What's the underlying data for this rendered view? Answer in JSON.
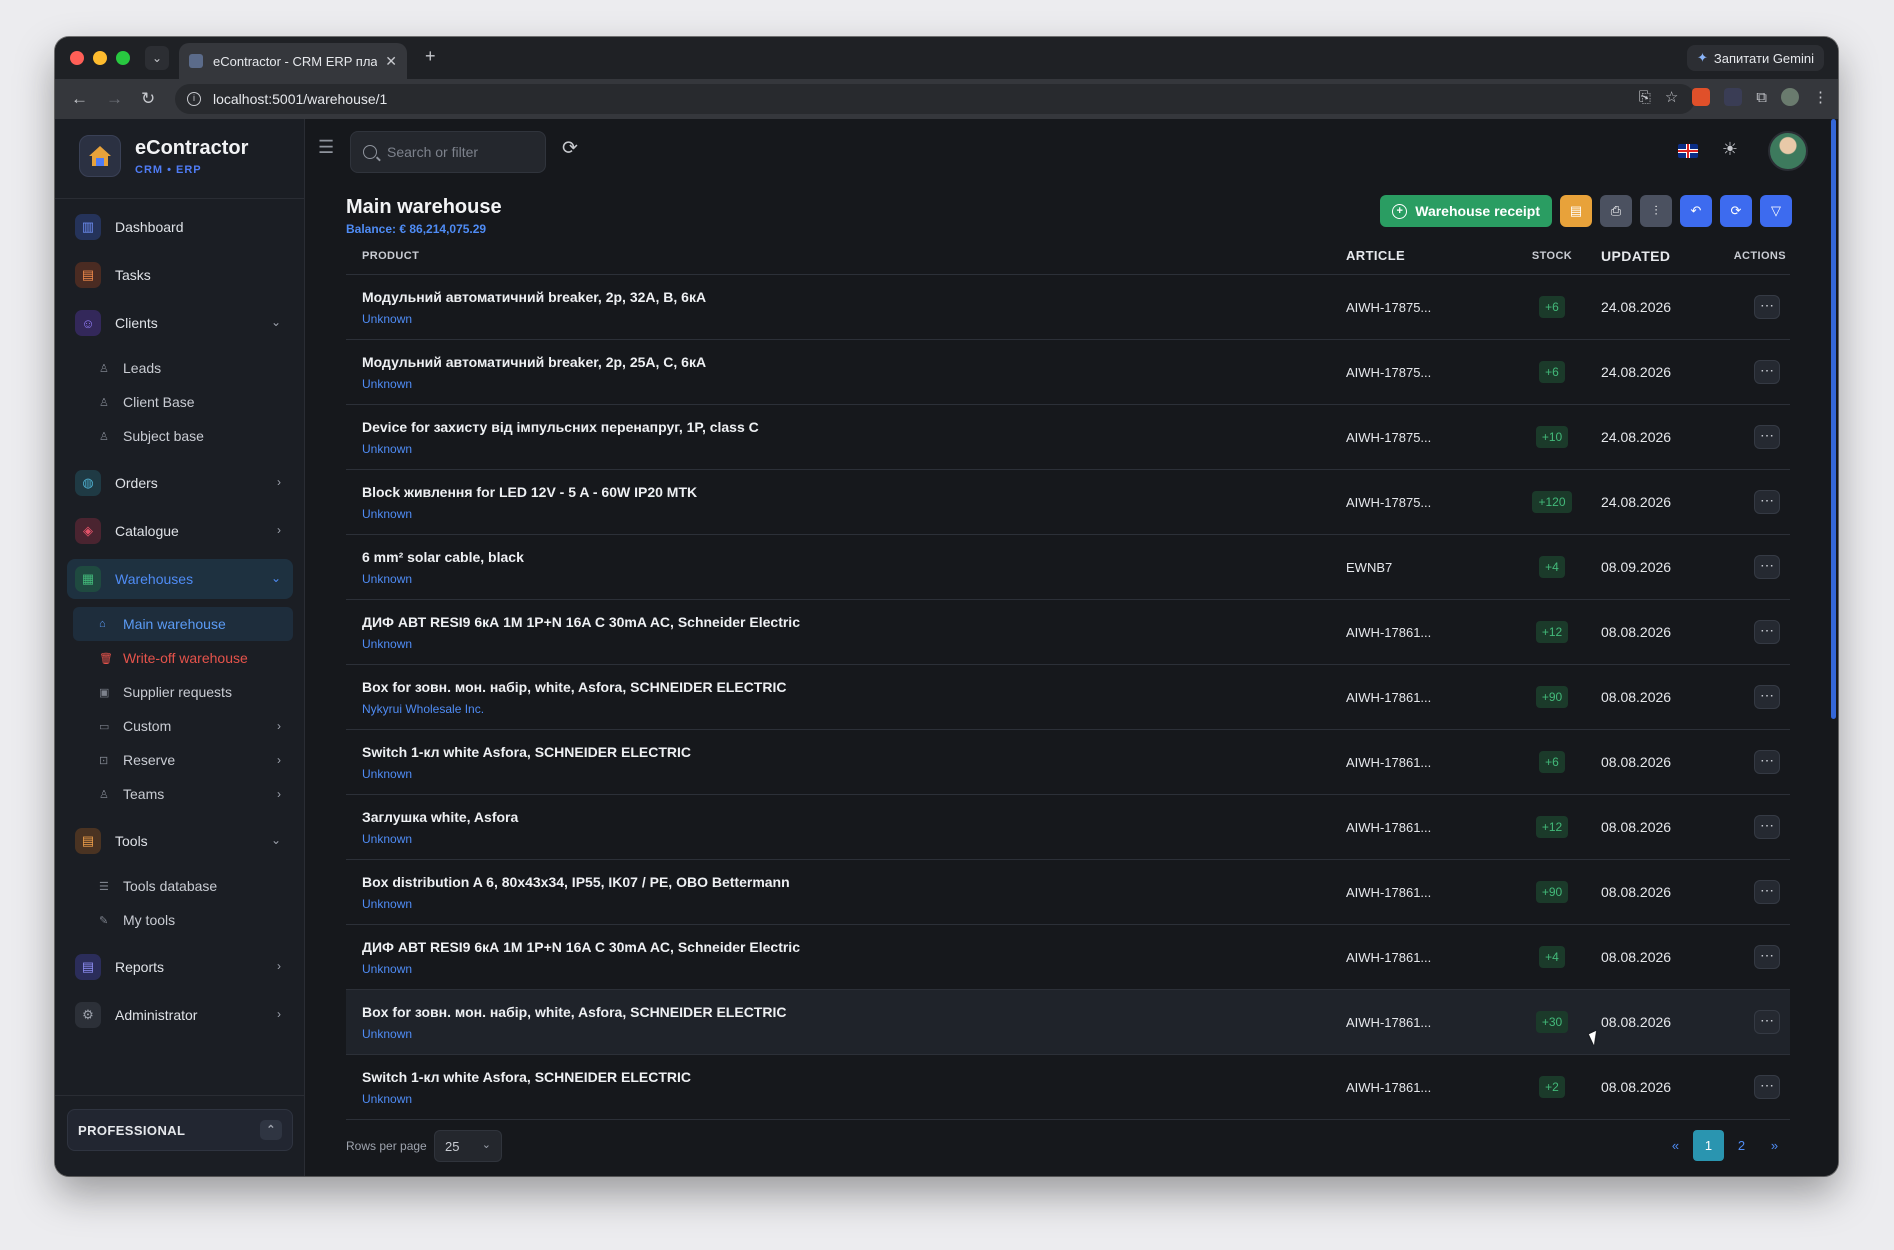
{
  "browser": {
    "tab_title": "eContractor - CRM ERP плат",
    "gemini_label": "Запитати Gemini",
    "url": "localhost:5001/warehouse/1"
  },
  "brand": {
    "name": "eContractor",
    "sub": "CRM • ERP"
  },
  "nav": {
    "dashboard": "Dashboard",
    "tasks": "Tasks",
    "clients": "Clients",
    "leads": "Leads",
    "client_base": "Client Base",
    "subject_base": "Subject base",
    "orders": "Orders",
    "catalogue": "Catalogue",
    "warehouses": "Warehouses",
    "main_warehouse": "Main warehouse",
    "writeoff_warehouse": "Write-off warehouse",
    "supplier_requests": "Supplier requests",
    "custom": "Custom",
    "reserve": "Reserve",
    "teams": "Teams",
    "tools": "Tools",
    "tools_database": "Tools database",
    "my_tools": "My tools",
    "reports": "Reports",
    "administrator": "Administrator"
  },
  "plan": "PROFESSIONAL",
  "search": {
    "placeholder": "Search or filter"
  },
  "page": {
    "title": "Main warehouse",
    "balance": "Balance: € 86,214,075.29"
  },
  "toolbar": {
    "receipt_label": "Warehouse receipt"
  },
  "table": {
    "headers": {
      "product": "PRODUCT",
      "article": "ARTICLE",
      "stock": "STOCK",
      "updated": "UPDATED",
      "actions": "ACTIONS"
    },
    "rows": [
      {
        "name": "Модульний автоматичний breaker, 2p, 32A, B, 6кA",
        "supplier": "Unknown",
        "article": "AIWH-17875...",
        "stock": "+6",
        "updated": "24.08.2026"
      },
      {
        "name": "Модульний автоматичний breaker, 2p, 25A, C, 6кA",
        "supplier": "Unknown",
        "article": "AIWH-17875...",
        "stock": "+6",
        "updated": "24.08.2026"
      },
      {
        "name": "Device for захисту від імпульсних перенапруг, 1P, class C",
        "supplier": "Unknown",
        "article": "AIWH-17875...",
        "stock": "+10",
        "updated": "24.08.2026"
      },
      {
        "name": "Block живлення for LED 12V - 5 A - 60W IP20 MTK",
        "supplier": "Unknown",
        "article": "AIWH-17875...",
        "stock": "+120",
        "updated": "24.08.2026"
      },
      {
        "name": "6 mm² solar cable, black",
        "supplier": "Unknown",
        "article": "EWNB7",
        "stock": "+4",
        "updated": "08.09.2026"
      },
      {
        "name": "ДИФ АВТ RESI9 6кА 1М 1P+N 16A C 30mA AC, Schneider Electric",
        "supplier": "Unknown",
        "article": "AIWH-17861...",
        "stock": "+12",
        "updated": "08.08.2026"
      },
      {
        "name": "Box for зовн. мон. набір, white, Asfora, SCHNEIDER ELECTRIC",
        "supplier": "Nykyrui Wholesale Inc.",
        "article": "AIWH-17861...",
        "stock": "+90",
        "updated": "08.08.2026"
      },
      {
        "name": "Switch 1-кл white Asfora, SCHNEIDER ELECTRIC",
        "supplier": "Unknown",
        "article": "AIWH-17861...",
        "stock": "+6",
        "updated": "08.08.2026"
      },
      {
        "name": "Заглушка white, Asfora",
        "supplier": "Unknown",
        "article": "AIWH-17861...",
        "stock": "+12",
        "updated": "08.08.2026"
      },
      {
        "name": "Box distribution A 6, 80x43x34, IP55, IK07 / PE, OBO Bettermann",
        "supplier": "Unknown",
        "article": "AIWH-17861...",
        "stock": "+90",
        "updated": "08.08.2026"
      },
      {
        "name": "ДИФ АВТ RESI9 6кА 1М 1P+N 16A C 30mA AC, Schneider Electric",
        "supplier": "Unknown",
        "article": "AIWH-17861...",
        "stock": "+4",
        "updated": "08.08.2026"
      },
      {
        "name": "Box for зовн. мон. набір, white, Asfora, SCHNEIDER ELECTRIC",
        "supplier": "Unknown",
        "article": "AIWH-17861...",
        "stock": "+30",
        "updated": "08.08.2026"
      },
      {
        "name": "Switch 1-кл white Asfora, SCHNEIDER ELECTRIC",
        "supplier": "Unknown",
        "article": "AIWH-17861...",
        "stock": "+2",
        "updated": "08.08.2026"
      }
    ]
  },
  "pagination": {
    "rows_per_page_label": "Rows per page",
    "rows_per_page": "25",
    "prev": "«",
    "page1": "1",
    "page2": "2",
    "next": "»"
  },
  "colors": {
    "accent": "#4f8cf5",
    "success": "#2a9d62",
    "danger": "#e5534b",
    "warning": "#e8a23a"
  }
}
